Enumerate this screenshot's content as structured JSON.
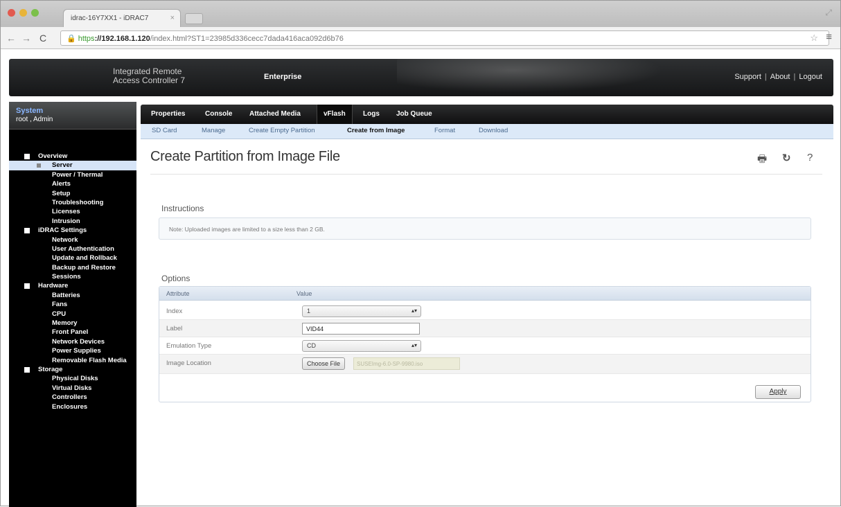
{
  "browser": {
    "tab_title": "idrac-16Y7XX1 - iDRAC7",
    "url_scheme": "https",
    "url_host": "://192.168.1.120",
    "url_path": "/index.html?ST1=23985d336cecc7dada416aca092d6b76"
  },
  "header": {
    "product_line1": "Integrated Remote",
    "product_line2": "Access Controller 7",
    "edition": "Enterprise",
    "links": [
      "Support",
      "About",
      "Logout"
    ]
  },
  "sidebar": {
    "system_title": "System",
    "user": "root , Admin",
    "tree": [
      {
        "label": "Overview",
        "level": 0,
        "box": true
      },
      {
        "label": "Server",
        "level": 1,
        "selected": true,
        "minus": true
      },
      {
        "label": "Power / Thermal",
        "level": 1
      },
      {
        "label": "Alerts",
        "level": 1
      },
      {
        "label": "Setup",
        "level": 1
      },
      {
        "label": "Troubleshooting",
        "level": 1
      },
      {
        "label": "Licenses",
        "level": 1
      },
      {
        "label": "Intrusion",
        "level": 1
      },
      {
        "label": "iDRAC Settings",
        "level": 0,
        "box": true
      },
      {
        "label": "Network",
        "level": 1
      },
      {
        "label": "User Authentication",
        "level": 1
      },
      {
        "label": "Update and Rollback",
        "level": 1
      },
      {
        "label": "Backup and Restore",
        "level": 1
      },
      {
        "label": "Sessions",
        "level": 1
      },
      {
        "label": "Hardware",
        "level": 0,
        "box": true
      },
      {
        "label": "Batteries",
        "level": 1
      },
      {
        "label": "Fans",
        "level": 1
      },
      {
        "label": "CPU",
        "level": 1
      },
      {
        "label": "Memory",
        "level": 1
      },
      {
        "label": "Front Panel",
        "level": 1
      },
      {
        "label": "Network Devices",
        "level": 1
      },
      {
        "label": "Power Supplies",
        "level": 1
      },
      {
        "label": "Removable Flash Media",
        "level": 1
      },
      {
        "label": "Storage",
        "level": 0,
        "box": true
      },
      {
        "label": "Physical Disks",
        "level": 1
      },
      {
        "label": "Virtual Disks",
        "level": 1
      },
      {
        "label": "Controllers",
        "level": 1
      },
      {
        "label": "Enclosures",
        "level": 1
      }
    ]
  },
  "main_tabs": [
    "Properties",
    "Console",
    "Attached Media",
    "vFlash",
    "Logs",
    "Job Queue"
  ],
  "sub_tabs": [
    "SD Card",
    "Manage",
    "Create Empty Partition",
    "Create from Image",
    "Format",
    "Download"
  ],
  "page": {
    "title": "Create Partition from Image File",
    "instructions_label": "Instructions",
    "note": "Note: Uploaded images are limited to a size less than 2 GB.",
    "options_label": "Options",
    "col_attribute": "Attribute",
    "col_value": "Value",
    "rows": {
      "index_label": "Index",
      "index_value": "1",
      "label_label": "Label",
      "label_value": "VID44",
      "emulation_label": "Emulation Type",
      "emulation_value": "CD",
      "image_label": "Image Location",
      "choose_file": "Choose File",
      "file_name": "SUSEImg-6.0-SP-9980.iso"
    },
    "apply": "Apply"
  }
}
